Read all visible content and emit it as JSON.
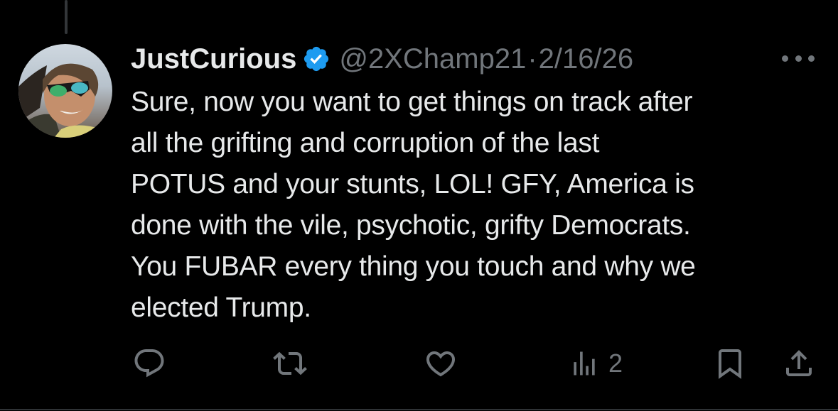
{
  "tweet": {
    "display_name": "JustCurious",
    "handle": "@2XChamp21",
    "separator": "·",
    "date": "2/16/26",
    "text": "Sure, now you want to get things on track after\nall the grifting and corruption of the last\nPOTUS and your stunts, LOL! GFY, America is\ndone with the vile, psychotic, grifty Democrats.\nYou FUBAR every thing you touch and why we\nelected Trump."
  },
  "actions": {
    "views_count": "2"
  },
  "colors": {
    "background": "#000000",
    "text": "#e7e9ea",
    "secondary": "#71767b",
    "verified": "#1d9bf0",
    "divider": "#2f3336"
  },
  "icons": {
    "verified": "verified-badge-icon",
    "more": "more-horizontal-icon",
    "reply": "reply-icon",
    "retweet": "retweet-icon",
    "like": "heart-icon",
    "views": "views-chart-icon",
    "bookmark": "bookmark-icon",
    "share": "share-icon"
  }
}
